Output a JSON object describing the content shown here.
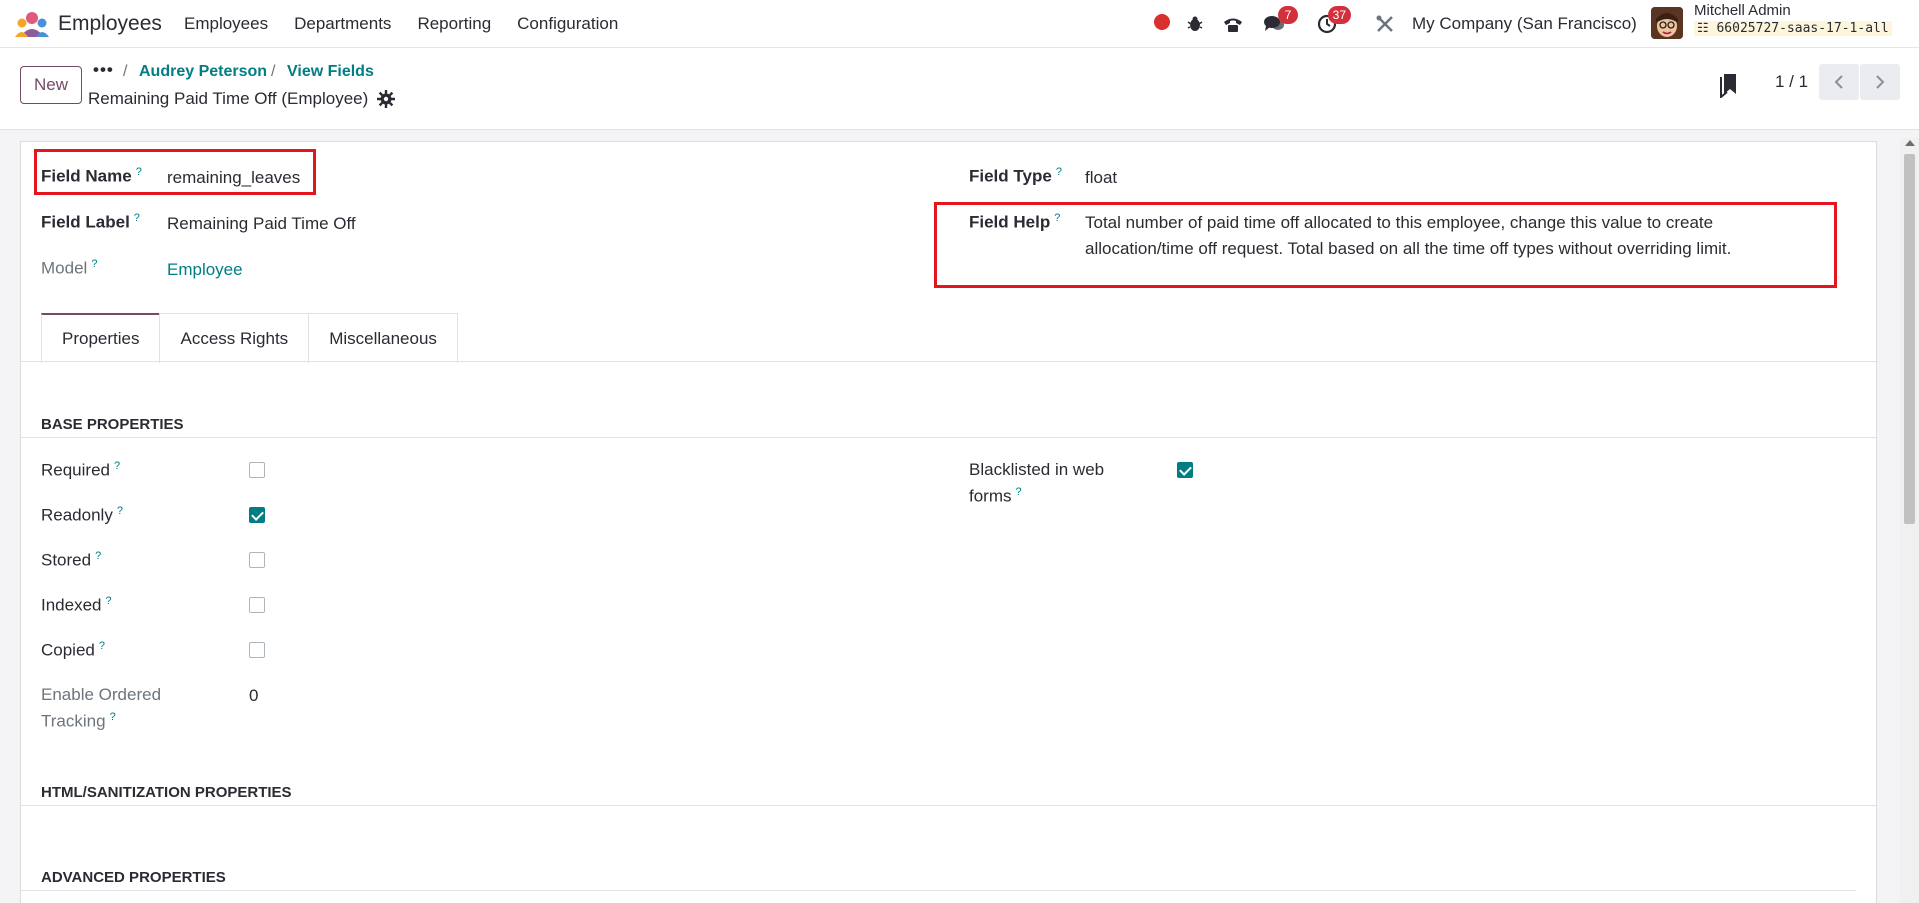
{
  "navbar": {
    "app_name": "Employees",
    "menu": [
      "Employees",
      "Departments",
      "Reporting",
      "Configuration"
    ],
    "chat_badge": "7",
    "activity_badge": "37",
    "company": "My Company (San Francisco)",
    "user_name": "Mitchell Admin",
    "db_name": "66025727-saas-17-1-all"
  },
  "control": {
    "new_label": "New",
    "more_label": "•••",
    "crumb_sep": "/",
    "breadcrumb": [
      "Audrey Peterson",
      "View Fields"
    ],
    "record_title": "Remaining Paid Time Off (Employee)",
    "pager": "1 / 1"
  },
  "form": {
    "help_mark": "?",
    "field_name_label": "Field Name",
    "field_name_value": "remaining_leaves",
    "field_label_label": "Field Label",
    "field_label_value": "Remaining Paid Time Off",
    "model_label": "Model",
    "model_value": "Employee",
    "field_type_label": "Field Type",
    "field_type_value": "float",
    "field_help_label": "Field Help",
    "field_help_line1": "Total number of paid time off allocated to this employee, change this value to create",
    "field_help_line2": "allocation/time off request. Total based on all the time off types without overriding limit."
  },
  "tabs": [
    "Properties",
    "Access Rights",
    "Miscellaneous"
  ],
  "sections": {
    "base": "BASE PROPERTIES",
    "html": "HTML/SANITIZATION PROPERTIES",
    "advanced": "ADVANCED PROPERTIES"
  },
  "properties": {
    "required": {
      "label": "Required",
      "checked": false
    },
    "readonly": {
      "label": "Readonly",
      "checked": true
    },
    "stored": {
      "label": "Stored",
      "checked": false
    },
    "indexed": {
      "label": "Indexed",
      "checked": false
    },
    "copied": {
      "label": "Copied",
      "checked": false
    },
    "tracking_label_1": "Enable Ordered",
    "tracking_label_2": "Tracking",
    "tracking_value": "0",
    "blacklisted_label_1": "Blacklisted in web",
    "blacklisted_label_2": "forms",
    "blacklisted_checked": true
  },
  "colors": {
    "brand": "#714b67",
    "link": "#017e84",
    "highlight": "#e3161d",
    "badge": "#d2303b"
  }
}
